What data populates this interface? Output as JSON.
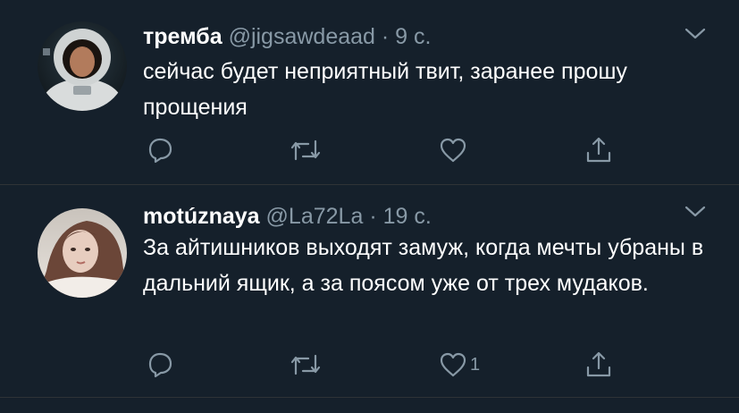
{
  "colors": {
    "background": "#15202b",
    "text_primary": "#ffffff",
    "text_secondary": "#8899a6",
    "divider": "#2f3336"
  },
  "tweets": [
    {
      "author_name": "тремба",
      "handle": "@jigsawdeaad",
      "separator": "·",
      "time": "9 с.",
      "text": "сейчас будет неприятный твит, заранее прошу прощения",
      "like_count": "",
      "icons": [
        "reply-icon",
        "retweet-icon",
        "like-icon",
        "share-icon",
        "chevron-down-icon"
      ]
    },
    {
      "author_name": "motúznaya",
      "handle": "@La72La",
      "separator": "·",
      "time": "19 с.",
      "text": "За айтишников выходят замуж, когда мечты убраны в дальний ящик, а за поясом уже от трех мудаков.",
      "like_count": "1",
      "icons": [
        "reply-icon",
        "retweet-icon",
        "like-icon",
        "share-icon",
        "chevron-down-icon"
      ]
    }
  ]
}
